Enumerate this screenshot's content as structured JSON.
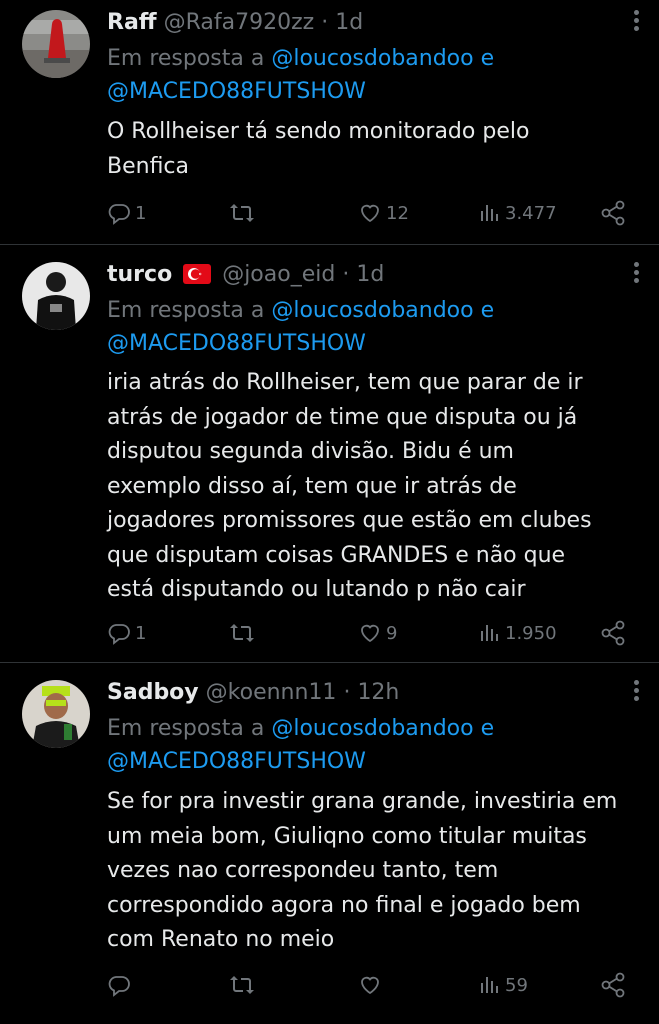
{
  "colors": {
    "background": "#000000",
    "text": "#e7e9ea",
    "muted": "#71767b",
    "link": "#1d9bf0",
    "divider": "#2f3336"
  },
  "tweets": [
    {
      "name": "Raff",
      "handle": "@Rafa7920zz",
      "dot": "·",
      "time": "1d",
      "reply_prefix": "Em resposta a",
      "mention1": "@loucosdobandoo",
      "and": "e",
      "mention2": "@MACEDO88FUTSHOW",
      "text_lines": [
        "O Rollheiser tá sendo monitorado pelo",
        "Benfica"
      ],
      "replies": "1",
      "retweets": "",
      "likes": "12",
      "views": "3.477"
    },
    {
      "name": "turco",
      "flag": "turkey-flag-icon",
      "handle": "@joao_eid",
      "dot": "·",
      "time": "1d",
      "reply_prefix": "Em resposta a",
      "mention1": "@loucosdobandoo",
      "and": "e",
      "mention2": "@MACEDO88FUTSHOW",
      "text_lines": [
        "iria atrás do Rollheiser, tem que parar de ir",
        "atrás de jogador de time que disputa ou já",
        "disputou segunda divisão. Bidu é um",
        "exemplo disso aí, tem que ir atrás de",
        "jogadores promissores que estão em clubes",
        "que disputam coisas GRANDES e não que",
        "está disputando ou lutando p não cair"
      ],
      "replies": "1",
      "retweets": "",
      "likes": "9",
      "views": "1.950"
    },
    {
      "name": "Sadboy",
      "handle": "@koennn11",
      "dot": "·",
      "time": "12h",
      "reply_prefix": "Em resposta a",
      "mention1": "@loucosdobandoo",
      "and": "e",
      "mention2": "@MACEDO88FUTSHOW",
      "text_lines": [
        "Se for pra investir grana grande, investiria em",
        "um meia bom, Giuliqno como titular muitas",
        "vezes nao correspondeu tanto, tem",
        "correspondido agora no final e jogado bem",
        "com Renato no meio"
      ],
      "replies": "",
      "retweets": "",
      "likes": "",
      "views": "59"
    }
  ]
}
